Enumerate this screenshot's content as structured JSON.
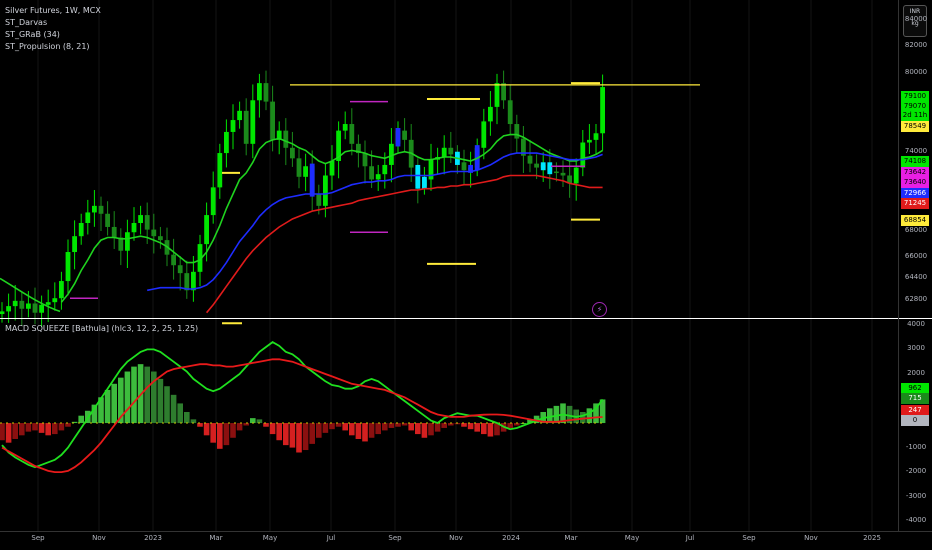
{
  "header": {
    "symbol_line": "Silver Futures, 1W, MCX",
    "indicators": [
      "ST_Darvas",
      "ST_GRaB (34)",
      "ST_Propulsion (8, 21)"
    ],
    "currency": "INR",
    "unit": "kg"
  },
  "lower_pane": {
    "title": "MACD SQUEEZE [Bathula] (hlc3, 12, 2, 25, 1.25)"
  },
  "price_axis": {
    "ticks": [
      "84000",
      "82000",
      "80000",
      "78000",
      "76000",
      "74000",
      "72000",
      "70000",
      "68000",
      "66000",
      "64400",
      "62800"
    ],
    "markers": [
      {
        "text": "79100",
        "bg": "#00e600",
        "fg": "#000000"
      },
      {
        "text": "79070",
        "bg": "#00e600",
        "fg": "#000000"
      },
      {
        "text": "2d 11h",
        "bg": "#00e600",
        "fg": "#000000"
      },
      {
        "text": "78549",
        "bg": "#ffeb3b",
        "fg": "#000000"
      },
      {
        "text": "74108",
        "bg": "#00e600",
        "fg": "#000000"
      },
      {
        "text": "73642",
        "bg": "#e91ee4",
        "fg": "#000000"
      },
      {
        "text": "73640",
        "bg": "#e91ee4",
        "fg": "#000000"
      },
      {
        "text": "72966",
        "bg": "#1e2cff",
        "fg": "#ffffff"
      },
      {
        "text": "71245",
        "bg": "#e01b1b",
        "fg": "#ffffff"
      },
      {
        "text": "68854",
        "bg": "#ffeb3b",
        "fg": "#000000"
      }
    ]
  },
  "macd_axis": {
    "ticks": [
      "4000",
      "3000",
      "2000",
      "1000",
      "0",
      "-1000",
      "-2000",
      "-3000",
      "-4000"
    ],
    "markers": [
      {
        "text": "962",
        "bg": "#00e600",
        "fg": "#000000"
      },
      {
        "text": "715",
        "bg": "#1b8a1b",
        "fg": "#ffffff"
      },
      {
        "text": "247",
        "bg": "#e01b1b",
        "fg": "#ffffff"
      },
      {
        "text": "0",
        "bg": "#b2b5be",
        "fg": "#000000"
      }
    ]
  },
  "time_axis": {
    "ticks": [
      "Sep",
      "Nov",
      "2023",
      "Mar",
      "May",
      "Jul",
      "Sep",
      "Nov",
      "2024",
      "Mar",
      "May",
      "Jul",
      "Sep",
      "Nov",
      "2025"
    ]
  },
  "colors": {
    "up": "#00e600",
    "down": "#1b8a1b",
    "blue": "#1e2cff",
    "red": "#e01b1b",
    "green_line": "#1fd31f",
    "yellow": "#ffeb3b",
    "magenta": "#c026c0",
    "cyan": "#00e5ff"
  },
  "icons": {
    "lightning": "lightning-icon"
  },
  "chart_data": [
    {
      "type": "candlestick",
      "title": "Silver Futures, 1W, MCX",
      "ylim": [
        61400,
        85500
      ],
      "weekly_close": [
        61900,
        62300,
        62700,
        62100,
        62500,
        61800,
        62400,
        62600,
        62900,
        64200,
        66400,
        67600,
        68600,
        69400,
        69900,
        69300,
        68300,
        67500,
        66500,
        67900,
        68600,
        69200,
        68100,
        67600,
        67300,
        66200,
        65400,
        64800,
        63500,
        64900,
        67000,
        69200,
        71300,
        73900,
        75500,
        76400,
        77100,
        74600,
        77900,
        79200,
        77800,
        74900,
        75600,
        74300,
        73500,
        72100,
        72900,
        70800,
        69900,
        72200,
        73300,
        75600,
        76100,
        74600,
        73900,
        72900,
        71900,
        72300,
        73000,
        74600,
        75600,
        74900,
        72800,
        71400,
        71900,
        73400,
        73600,
        74300,
        73800,
        73200,
        72600,
        72800,
        74300,
        76300,
        77400,
        79200,
        77900,
        76100,
        75000,
        73700,
        73100,
        72800,
        73000,
        72500,
        72400,
        72200,
        71600,
        72800,
        74700,
        74900,
        75400,
        78900
      ],
      "series": [
        {
          "name": "ST_Propulsion (8, 21) fast",
          "values": [
            null,
            null,
            null,
            null,
            null,
            null,
            null,
            null,
            null,
            62600,
            63200,
            64000,
            65000,
            65800,
            66700,
            67300,
            67500,
            67500,
            67400,
            67400,
            67500,
            67600,
            67500,
            67300,
            67100,
            66800,
            66400,
            66000,
            65600,
            65600,
            65800,
            66400,
            67300,
            68400,
            69700,
            70800,
            71900,
            72400,
            73200,
            74200,
            74700,
            74900,
            75000,
            74800,
            74600,
            74300,
            74100,
            73700,
            73300,
            73100,
            73300,
            73600,
            74000,
            74100,
            74000,
            73900,
            73700,
            73600,
            73500,
            73700,
            73900,
            74000,
            73900,
            73600,
            73400,
            73400,
            73500,
            73600,
            73600,
            73500,
            73400,
            73300,
            73500,
            73800,
            74200,
            74800,
            75200,
            75300,
            75300,
            75100,
            74800,
            74500,
            74200,
            73900,
            73700,
            73500,
            73300,
            73300,
            73500,
            73600,
            73800,
            74100
          ]
        },
        {
          "name": "ST_Propulsion (8, 21) slow",
          "values": [
            null,
            null,
            null,
            null,
            null,
            null,
            null,
            null,
            null,
            null,
            null,
            null,
            null,
            null,
            null,
            null,
            null,
            null,
            null,
            null,
            null,
            null,
            63500,
            63600,
            63700,
            63700,
            63700,
            63700,
            63600,
            63600,
            63700,
            63900,
            64300,
            64900,
            65600,
            66400,
            67200,
            67800,
            68400,
            69100,
            69600,
            70000,
            70300,
            70500,
            70600,
            70700,
            70800,
            70800,
            70800,
            70800,
            70900,
            71100,
            71300,
            71500,
            71600,
            71700,
            71700,
            71800,
            71800,
            71900,
            72100,
            72200,
            72200,
            72200,
            72200,
            72200,
            72300,
            72400,
            72500,
            72500,
            72500,
            72500,
            72600,
            72800,
            73000,
            73300,
            73600,
            73800,
            73900,
            73900,
            73900,
            73900,
            73800,
            73700,
            73600,
            73500,
            73400,
            73400,
            73400,
            73500,
            73600,
            73800
          ]
        },
        {
          "name": "ST_GRaB (34) base",
          "values": [
            null,
            null,
            null,
            null,
            null,
            null,
            null,
            null,
            null,
            null,
            null,
            null,
            null,
            null,
            null,
            null,
            null,
            null,
            null,
            null,
            null,
            null,
            null,
            null,
            null,
            null,
            null,
            null,
            null,
            null,
            null,
            61800,
            62400,
            63100,
            63800,
            64500,
            65200,
            65900,
            66500,
            67000,
            67500,
            67900,
            68300,
            68600,
            68900,
            69100,
            69300,
            69500,
            69600,
            69700,
            69800,
            69900,
            70000,
            70100,
            70300,
            70400,
            70500,
            70600,
            70700,
            70800,
            70900,
            71000,
            71100,
            71100,
            71200,
            71200,
            71300,
            71300,
            71400,
            71400,
            71500,
            71500,
            71600,
            71700,
            71800,
            71900,
            72100,
            72200,
            72200,
            72200,
            72200,
            72200,
            72100,
            72000,
            71900,
            71800,
            71600,
            71500,
            71400,
            71300,
            71300,
            71300
          ]
        }
      ],
      "horizontal_levels": [
        {
          "name": "ST_Darvas top",
          "value": 79070
        },
        {
          "name": "ST_Darvas bottom",
          "value": 68854
        }
      ]
    },
    {
      "type": "bar",
      "title": "MACD SQUEEZE [Bathula] (hlc3, 12, 2, 25, 1.25)",
      "ylim": [
        -4400,
        4200
      ],
      "histogram": [
        -700,
        -800,
        -650,
        -500,
        -350,
        -300,
        -400,
        -500,
        -450,
        -300,
        -150,
        50,
        300,
        500,
        750,
        1050,
        1350,
        1600,
        1850,
        2100,
        2300,
        2400,
        2300,
        2100,
        1800,
        1500,
        1150,
        800,
        450,
        150,
        -150,
        -500,
        -800,
        -1050,
        -900,
        -600,
        -300,
        -100,
        200,
        150,
        -150,
        -450,
        -700,
        -900,
        -1000,
        -1200,
        -1100,
        -850,
        -600,
        -400,
        -250,
        -150,
        -300,
        -500,
        -650,
        -750,
        -600,
        -450,
        -300,
        -200,
        -150,
        -100,
        -300,
        -450,
        -600,
        -500,
        -350,
        -200,
        -100,
        -50,
        -150,
        -250,
        -350,
        -450,
        -550,
        -500,
        -350,
        -200,
        -100,
        0,
        150,
        300,
        450,
        600,
        700,
        800,
        700,
        550,
        450,
        600,
        800,
        962
      ],
      "series": [
        {
          "name": "MACD",
          "values": [
            -900,
            -1200,
            -1400,
            -1550,
            -1700,
            -1800,
            -1700,
            -1600,
            -1500,
            -1300,
            -1000,
            -600,
            -200,
            200,
            600,
            1000,
            1400,
            1800,
            2200,
            2500,
            2700,
            2900,
            3000,
            3000,
            2900,
            2700,
            2500,
            2300,
            2100,
            1800,
            1600,
            1400,
            1300,
            1400,
            1600,
            1800,
            2000,
            2300,
            2600,
            2900,
            3100,
            3300,
            3150,
            2900,
            2800,
            2600,
            2300,
            2100,
            1900,
            1700,
            1550,
            1500,
            1400,
            1400,
            1500,
            1700,
            1800,
            1700,
            1500,
            1300,
            1100,
            900,
            700,
            500,
            300,
            100,
            0,
            200,
            300,
            400,
            350,
            300,
            300,
            200,
            100,
            0,
            -150,
            -250,
            -200,
            -100,
            0,
            100,
            200,
            250,
            300,
            350,
            300,
            250,
            300,
            400,
            600,
            962
          ]
        },
        {
          "name": "Signal",
          "values": [
            -1000,
            -1150,
            -1300,
            -1450,
            -1600,
            -1750,
            -1850,
            -1950,
            -2000,
            -2000,
            -1950,
            -1800,
            -1600,
            -1350,
            -1100,
            -800,
            -450,
            -100,
            250,
            550,
            850,
            1150,
            1450,
            1700,
            1900,
            2100,
            2200,
            2250,
            2300,
            2350,
            2400,
            2400,
            2350,
            2350,
            2300,
            2300,
            2350,
            2400,
            2450,
            2500,
            2550,
            2600,
            2600,
            2550,
            2500,
            2400,
            2300,
            2200,
            2100,
            2000,
            1900,
            1800,
            1700,
            1600,
            1550,
            1500,
            1450,
            1400,
            1350,
            1250,
            1150,
            1050,
            900,
            750,
            600,
            450,
            350,
            300,
            250,
            250,
            250,
            300,
            320,
            340,
            350,
            350,
            330,
            300,
            250,
            200,
            150,
            100,
            50,
            50,
            50,
            80,
            120,
            150,
            180,
            200,
            230,
            247
          ]
        }
      ]
    }
  ]
}
